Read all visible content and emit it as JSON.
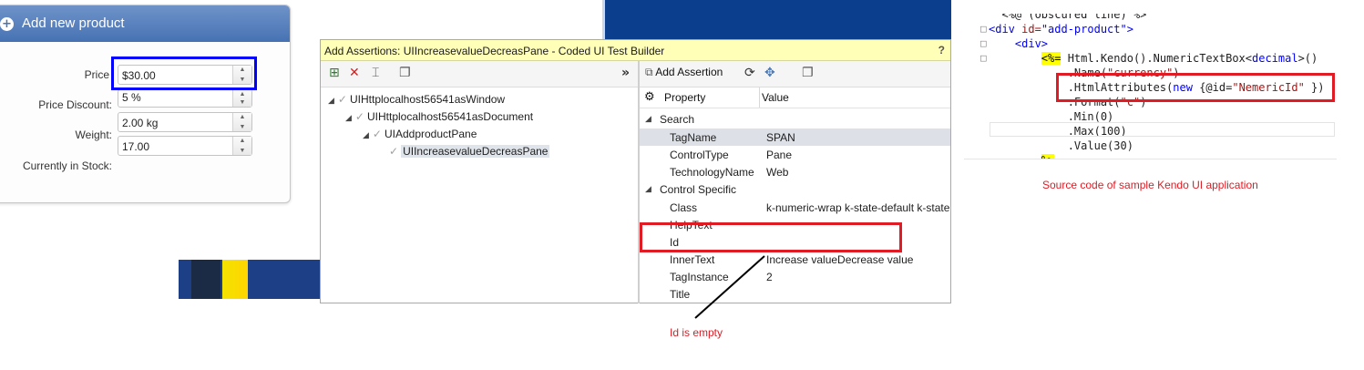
{
  "kendo_form": {
    "header_title": "Add new product",
    "fields": [
      {
        "label": "Price",
        "value": "$30.00"
      },
      {
        "label": "Price Discount:",
        "value": "5 %"
      },
      {
        "label": "Weight:",
        "value": "2.00 kg"
      },
      {
        "label": "",
        "value": "17.00"
      },
      {
        "label": "Currently in Stock:",
        "value": ""
      }
    ]
  },
  "coded_ui": {
    "title": "Add Assertions: UIIncreasevalueDecreasPane - Coded UI Test Builder",
    "help": "?",
    "collapse_glyph": "»",
    "add_assertion_label": "Add Assertion",
    "tree": [
      {
        "label": "UIHttplocalhost56541asWindow",
        "level": 0
      },
      {
        "label": "UIHttplocalhost56541asDocument",
        "level": 1
      },
      {
        "label": "UIAddproductPane",
        "level": 2
      },
      {
        "label": "UIIncreasevalueDecreasPane",
        "level": 3,
        "selected": true
      }
    ],
    "property_col": "Property",
    "value_col": "Value",
    "categories": [
      {
        "name": "Search",
        "rows": [
          {
            "name": "TagName",
            "value": "SPAN",
            "selected": true
          },
          {
            "name": "ControlType",
            "value": "Pane"
          },
          {
            "name": "TechnologyName",
            "value": "Web"
          }
        ]
      },
      {
        "name": "Control Specific",
        "rows": [
          {
            "name": "Class",
            "value": "k-numeric-wrap k-state-default k-state"
          },
          {
            "name": "HelpText",
            "value": ""
          },
          {
            "name": "Id",
            "value": ""
          },
          {
            "name": "InnerText",
            "value": "Increase valueDecrease value"
          },
          {
            "name": "TagInstance",
            "value": "2"
          },
          {
            "name": "Title",
            "value": ""
          }
        ]
      }
    ]
  },
  "code": {
    "lines": [
      {
        "gutter": "",
        "parts": [
          [
            "txt",
            "  <%@ (obscured line) %>"
          ]
        ]
      },
      {
        "gutter": "□",
        "parts": [
          [
            "kw",
            "<div "
          ],
          [
            "str",
            "id="
          ],
          [
            "kw",
            "\"add-product\""
          ],
          [
            "kw",
            ">"
          ]
        ]
      },
      {
        "gutter": "□",
        "parts": [
          [
            "txt",
            "    "
          ],
          [
            "kw",
            "<div>"
          ]
        ]
      },
      {
        "gutter": "□",
        "parts": [
          [
            "txt",
            "        "
          ],
          [
            "hl",
            "<%="
          ],
          [
            "txt",
            " Html.Kendo().NumericTextBox<"
          ],
          [
            "kw",
            "decimal"
          ],
          [
            "txt",
            ">()"
          ]
        ]
      },
      {
        "gutter": "",
        "parts": [
          [
            "txt",
            "            .Name("
          ],
          [
            "str",
            "\"currency\""
          ],
          [
            "txt",
            ")"
          ]
        ]
      },
      {
        "gutter": "",
        "parts": [
          [
            "txt",
            "            .HtmlAttributes("
          ],
          [
            "kw",
            "new"
          ],
          [
            "txt",
            " {@id="
          ],
          [
            "str",
            "\"NemericId\""
          ],
          [
            "txt",
            " })"
          ]
        ]
      },
      {
        "gutter": "",
        "parts": [
          [
            "txt",
            "            .Format("
          ],
          [
            "str",
            "\"c\""
          ],
          [
            "txt",
            ")"
          ]
        ]
      },
      {
        "gutter": "",
        "parts": [
          [
            "txt",
            "            .Min(0)"
          ]
        ]
      },
      {
        "gutter": "",
        "parts": [
          [
            "txt",
            "            .Max(100)"
          ]
        ]
      },
      {
        "gutter": "",
        "parts": [
          [
            "txt",
            "            .Value(30)"
          ]
        ]
      },
      {
        "gutter": "",
        "parts": [
          [
            "txt",
            "        "
          ],
          [
            "hl",
            "%>"
          ]
        ]
      }
    ]
  },
  "annotations": {
    "source_code_caption": "Source code of sample Kendo UI application",
    "id_empty_caption": "Id is empty"
  },
  "colors": {
    "blue_highlight": "#0000ff",
    "red_annotation": "#e01b24",
    "titlebar_bg": "#ffffb8",
    "kendo_header": "#4672b3"
  }
}
